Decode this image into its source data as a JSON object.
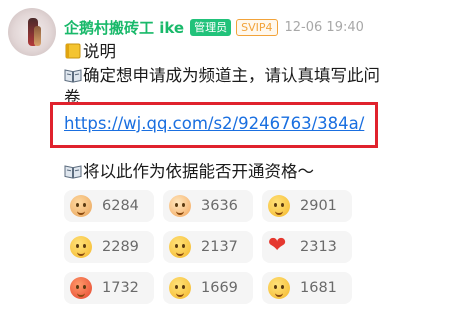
{
  "post": {
    "username": "企鹅村搬砖工 ike",
    "role_badge": "管理员",
    "vip_badge": "SVIP4",
    "timestamp": "12-06 19:40",
    "lines": {
      "title": "说明",
      "body_1": "确定想申请成为频道主，请认真填写此问",
      "body_2": "卷",
      "link": "https://wj.qq.com/s2/9246763/384a/",
      "body_3": "将以此作为依据能否开通资格～"
    }
  },
  "reactions": [
    {
      "icon": "dog-face-emoji",
      "count": "6284"
    },
    {
      "icon": "cat-face-emoji",
      "count": "3636"
    },
    {
      "icon": "cowboy-face-emoji",
      "count": "2901"
    },
    {
      "icon": "smile-face-emoji",
      "count": "2289"
    },
    {
      "icon": "hands-face-emoji",
      "count": "2137"
    },
    {
      "icon": "red-heart-emoji",
      "count": "2313"
    },
    {
      "icon": "angry-face-emoji",
      "count": "1732"
    },
    {
      "icon": "dizzy-face-emoji",
      "count": "1669"
    },
    {
      "icon": "shocked-face-emoji",
      "count": "1681"
    }
  ],
  "colors": {
    "username": "#19b96a",
    "admin_badge": "#21c27a",
    "svip_badge": "#f2a33a",
    "link": "#1a6fe0",
    "highlight_box": "#e0222d"
  }
}
